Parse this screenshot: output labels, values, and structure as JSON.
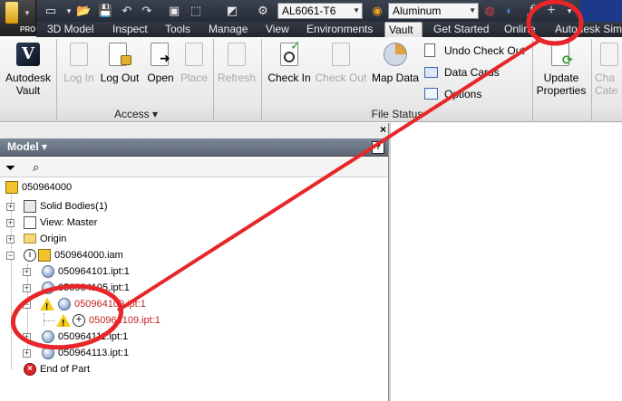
{
  "qat": {
    "material_field": "AL6061-T6",
    "appearance_field": "Aluminum",
    "app_logo_text": "PRO"
  },
  "tabs": [
    {
      "label": "3D Model"
    },
    {
      "label": "Inspect"
    },
    {
      "label": "Tools"
    },
    {
      "label": "Manage"
    },
    {
      "label": "View"
    },
    {
      "label": "Environments"
    },
    {
      "label": "Vault",
      "active": true
    },
    {
      "label": "Get Started"
    },
    {
      "label": "Online"
    },
    {
      "label": "Autodesk Simu"
    }
  ],
  "ribbon": {
    "autodesk_vault_label": "Autodesk Vault",
    "access": {
      "label": "Access ▾",
      "buttons": [
        "Log In",
        "Log Out",
        "Open",
        "Place"
      ]
    },
    "refresh_label": "Refresh",
    "file_status": {
      "label": "File Status",
      "check_in": "Check In",
      "check_out": "Check Out",
      "map_data": "Map Data",
      "undo_check_out": "Undo Check Out",
      "data_cards": "Data Cards",
      "options": "Options"
    },
    "update_properties": "Update Properties",
    "change_category_line1": "Cha",
    "change_category_line2": "Cate"
  },
  "browser": {
    "title": "Model ▾",
    "help": "?",
    "close": "×"
  },
  "tree": [
    {
      "label": "050964000",
      "icon": "assembly"
    },
    {
      "label": "Solid Bodies(1)",
      "icon": "solid-bodies"
    },
    {
      "label": "View: Master",
      "icon": "view"
    },
    {
      "label": "Origin",
      "icon": "folder"
    },
    {
      "label": "050964000.iam",
      "icon": "assembly"
    },
    {
      "label": "050964101.ipt:1",
      "icon": "part"
    },
    {
      "label": "050964105.ipt:1",
      "icon": "part"
    },
    {
      "label": "050964109.ipt:1",
      "icon": "part",
      "status": "warning"
    },
    {
      "label": "050964109.ipt:1",
      "icon": "part",
      "status": "warning"
    },
    {
      "label": "050964111.ipt:1",
      "icon": "part"
    },
    {
      "label": "050964113.ipt:1",
      "icon": "part"
    },
    {
      "label": "End of Part",
      "icon": "end-of-part"
    }
  ],
  "colors": {
    "annotation_red": "#e8262a",
    "error_text": "#c41f1f",
    "title_bar": "#262c36"
  }
}
